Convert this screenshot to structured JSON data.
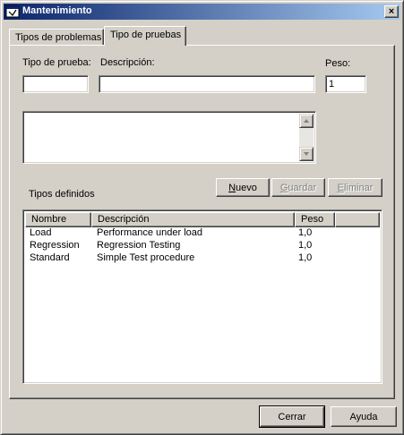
{
  "window": {
    "title": "Mantenimiento",
    "close_label": "×"
  },
  "tabs": [
    {
      "label": "Tipos de problemas",
      "active": false
    },
    {
      "label": "Tipo de pruebas",
      "active": true
    }
  ],
  "form": {
    "tipo_label": "Tipo de prueba:",
    "tipo_value": "",
    "descripcion_label": "Descripción:",
    "descripcion_value": "",
    "peso_label": "Peso:",
    "peso_value": "1",
    "memo_value": ""
  },
  "section_label": "Tipos definidos",
  "actions": {
    "nuevo": {
      "label": "Nuevo",
      "accel": "N",
      "rest": "uevo",
      "enabled": true
    },
    "guardar": {
      "label": "Guardar",
      "accel": "G",
      "rest": "uardar",
      "enabled": false
    },
    "eliminar": {
      "label": "Eliminar",
      "accel": "E",
      "rest": "liminar",
      "enabled": false
    }
  },
  "table": {
    "columns": [
      "Nombre",
      "Descripción",
      "Peso"
    ],
    "rows": [
      {
        "nombre": "Load",
        "descripcion": "Performance under load",
        "peso": "1,0"
      },
      {
        "nombre": "Regression",
        "descripcion": "Regression Testing",
        "peso": "1,0"
      },
      {
        "nombre": "Standard",
        "descripcion": "Simple Test procedure",
        "peso": "1,0"
      }
    ]
  },
  "footer": {
    "cerrar_label": "Cerrar",
    "ayuda_label": "Ayuda"
  },
  "colors": {
    "titlebar_start": "#0a246a",
    "titlebar_end": "#a6caf0",
    "face": "#d4d0c8"
  }
}
